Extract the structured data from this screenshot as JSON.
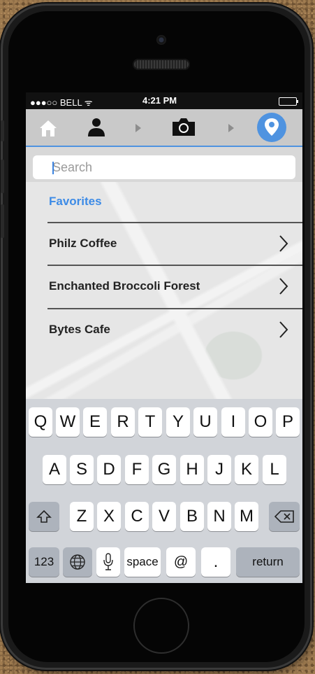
{
  "status_bar": {
    "carrier": "●●●○○ BELL ᯤ",
    "time": "4:21 PM"
  },
  "nav": {
    "icons": [
      "home-icon",
      "person-icon",
      "chevron-right-icon",
      "camera-icon",
      "chevron-right-icon",
      "location-pin-icon"
    ],
    "active": "location-pin-icon",
    "accent": "#4f93e0"
  },
  "search": {
    "placeholder": "Search"
  },
  "favorites": {
    "title": "Favorites",
    "items": [
      {
        "label": "Philz Coffee"
      },
      {
        "label": "Enchanted Broccoli Forest"
      },
      {
        "label": "Bytes Cafe"
      }
    ]
  },
  "keyboard": {
    "row1": [
      "Q",
      "W",
      "E",
      "R",
      "T",
      "Y",
      "U",
      "I",
      "O",
      "P"
    ],
    "row2": [
      "A",
      "S",
      "D",
      "F",
      "G",
      "H",
      "J",
      "K",
      "L"
    ],
    "row3": [
      "Z",
      "X",
      "C",
      "V",
      "B",
      "N",
      "M"
    ],
    "numbers_label": "123",
    "space_label": "space",
    "at_label": "@",
    "dot_label": ".",
    "return_label": "return"
  }
}
